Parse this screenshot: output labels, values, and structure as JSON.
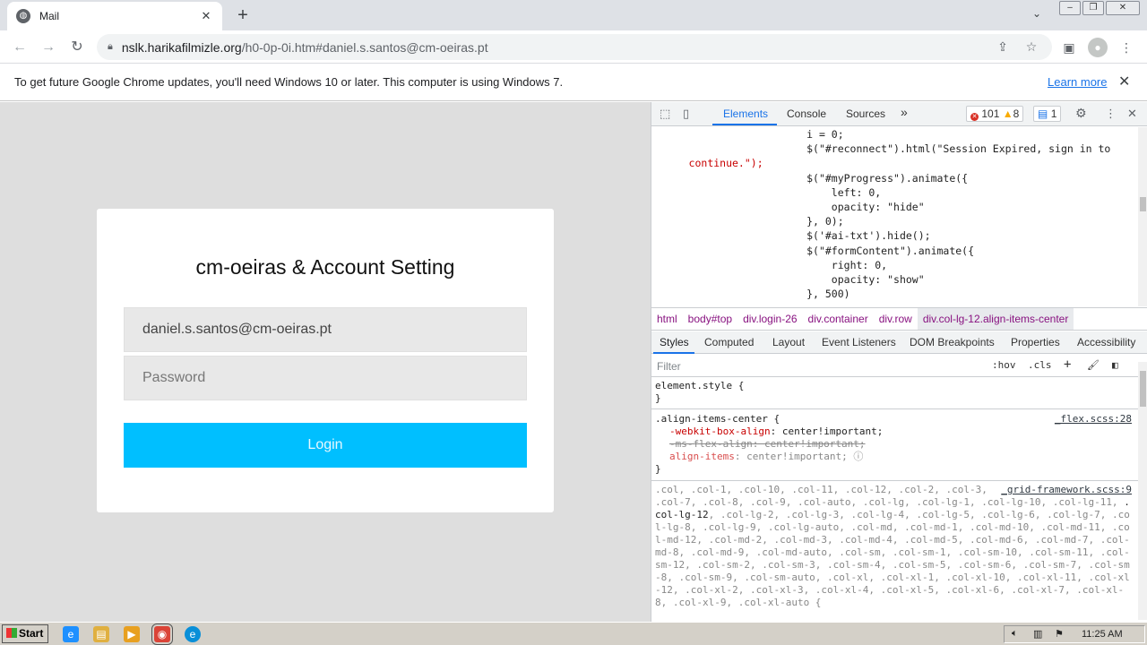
{
  "tab": {
    "title": "Mail",
    "favicon": "globe-icon"
  },
  "address": {
    "host": "nslk.harikafilmizle.org",
    "path": "/h0-0p-0i.htm#daniel.s.santos@cm-oeiras.pt"
  },
  "infobar": {
    "message": "To get future Google Chrome updates, you'll need Windows 10 or later. This computer is using Windows 7.",
    "learn_more": "Learn more"
  },
  "login": {
    "title": "cm-oeiras & Account Setting",
    "email_value": "daniel.s.santos@cm-oeiras.pt",
    "password_placeholder": "Password",
    "button_label": "Login",
    "button_color": "#00bfff"
  },
  "devtools": {
    "tabs": [
      "Elements",
      "Console",
      "Sources"
    ],
    "more": "»",
    "errors": "101",
    "warnings": "8",
    "messages": "1",
    "breadcrumbs": [
      "html",
      "body#top",
      "div.login-26",
      "div.container",
      "div.row",
      "div.col-lg-12.align-items-center"
    ],
    "subtabs": [
      "Styles",
      "Computed",
      "Layout",
      "Event Listeners",
      "DOM Breakpoints",
      "Properties",
      "Accessibility"
    ],
    "filter_placeholder": "Filter",
    "hov": ":hov",
    "cls": ".cls",
    "code_lines": [
      "i = 0;",
      "$(\"#reconnect\").html(\"Session Expired, sign in to",
      "continue.\");",
      "$(\"#myProgress\").animate({",
      "left: 0,",
      "opacity: \"hide\"",
      "}, 0);",
      "$('#ai-txt').hide();",
      "$(\"#formContent\").animate({",
      "right: 0,",
      "opacity: \"show\"",
      "}, 500)"
    ],
    "styles": {
      "element_style": "element.style {",
      "close": "}",
      "rule1_selector": ".align-items-center {",
      "rule1_source": "_flex.scss:28",
      "rule1_p1_name": "-webkit-box-align",
      "rule1_p1_value": ": center!important;",
      "rule1_p2": "-ms-flex-align: center!important;",
      "rule1_p3_name": "align-items",
      "rule1_p3_value": ": center!important;",
      "rule2_source": "_grid-framework.scss:9",
      "rule2_selectors_a": ".col, .col-1, .col-10, .col-11, .col-12, .col-2, .col-3, .col-4, .col-5, .col-6, .col-7, .col-8, .col-9, .col-auto, .col-lg, .col-lg-1, .col-lg-10, .col-lg-11, ",
      "rule2_selectors_b": ".col-lg-12",
      "rule2_selectors_c": ", .col-lg-2, .col-lg-3, .col-lg-4, .col-lg-5, .col-lg-6, .col-lg-7, .col-lg-8, .col-lg-9, .col-lg-auto, .col-md, .col-md-1, .col-md-10, .col-md-11, .col-md-12, .col-md-2, .col-md-3, .col-md-4, .col-md-5, .col-md-6, .col-md-7, .col-md-8, .col-md-9, .col-md-auto, .col-sm, .col-sm-1, .col-sm-10, .col-sm-11, .col-sm-12, .col-sm-2, .col-sm-3, .col-sm-4, .col-sm-5, .col-sm-6, .col-sm-7, .col-sm-8, .col-sm-9, .col-sm-auto, .col-xl, .col-xl-1, .col-xl-10, .col-xl-11, .col-xl-12, .col-xl-2, .col-xl-3, .col-xl-4, .col-xl-5, .col-xl-6, .col-xl-7, .col-xl-8, .col-xl-9, .col-xl-auto {"
    }
  },
  "taskbar": {
    "start": "Start",
    "clock": "11:25 AM"
  }
}
